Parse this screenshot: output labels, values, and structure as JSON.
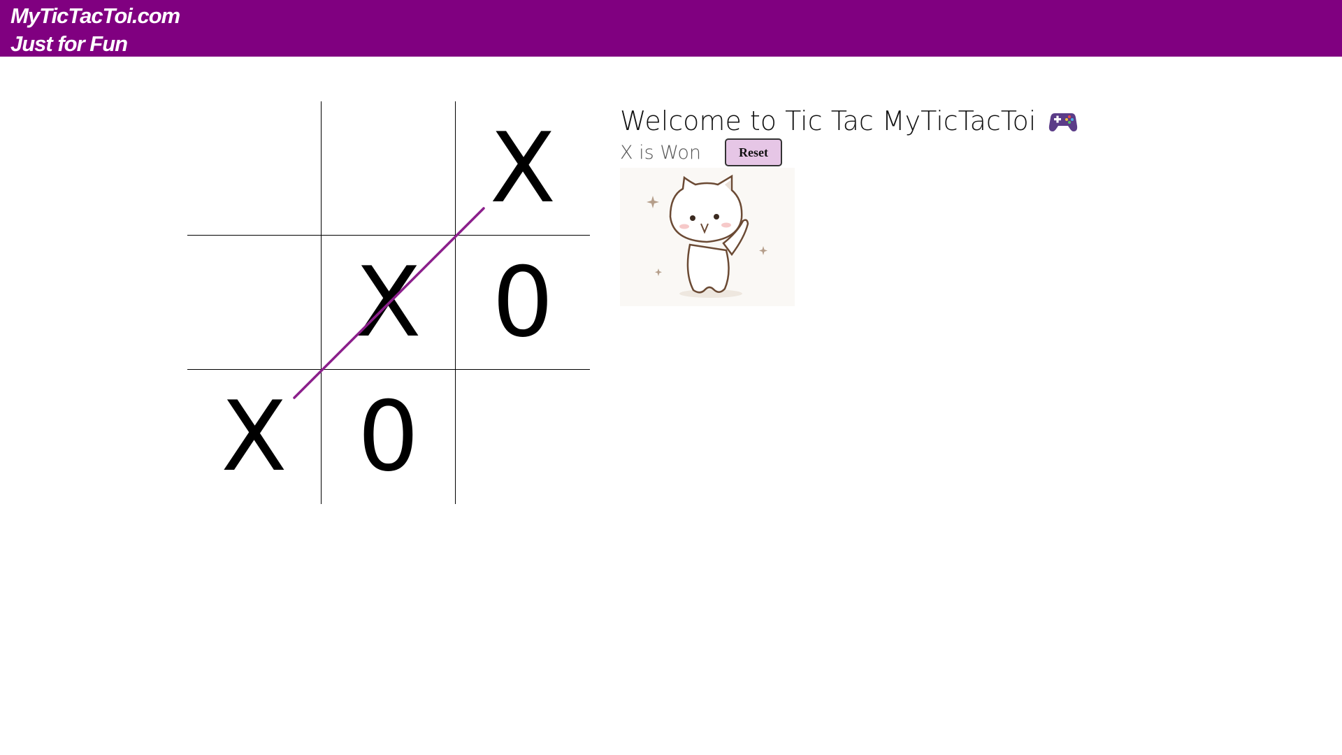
{
  "header": {
    "site_name": "MyTicTacToi.com",
    "tagline": "Just for Fun",
    "background_color": "#800080"
  },
  "board": {
    "cells": [
      [
        "",
        "",
        "X"
      ],
      [
        "",
        "X",
        "0"
      ],
      [
        "X",
        "0",
        ""
      ]
    ],
    "winner_line": "anti-diagonal",
    "winner_line_color": "#8b1f8b"
  },
  "info": {
    "title": "Welcome to Tic Tac MyTicTacToi",
    "title_icon": "gamepad-icon",
    "status": "X is Won",
    "reset_label": "Reset",
    "reset_color": "#e6c6e6",
    "celebration_image": "dancing-cat-sticker"
  }
}
